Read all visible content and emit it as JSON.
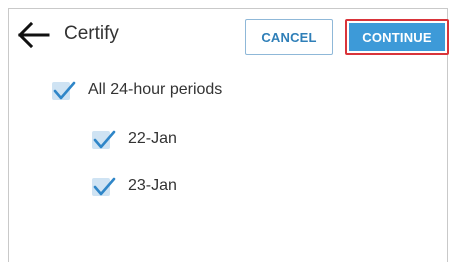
{
  "header": {
    "title": "Certify",
    "back_icon": "arrow-left-icon",
    "cancel_label": "CANCEL",
    "continue_label": "CONTINUE"
  },
  "checklist": {
    "all": {
      "label": "All 24-hour periods",
      "checked": true
    },
    "items": [
      {
        "label": "22-Jan",
        "checked": true
      },
      {
        "label": "23-Jan",
        "checked": true
      }
    ]
  },
  "colors": {
    "accent": "#3d9ad8",
    "check": "#2f86c8",
    "check_bg": "#cfe3f3",
    "highlight": "#d9343a"
  }
}
